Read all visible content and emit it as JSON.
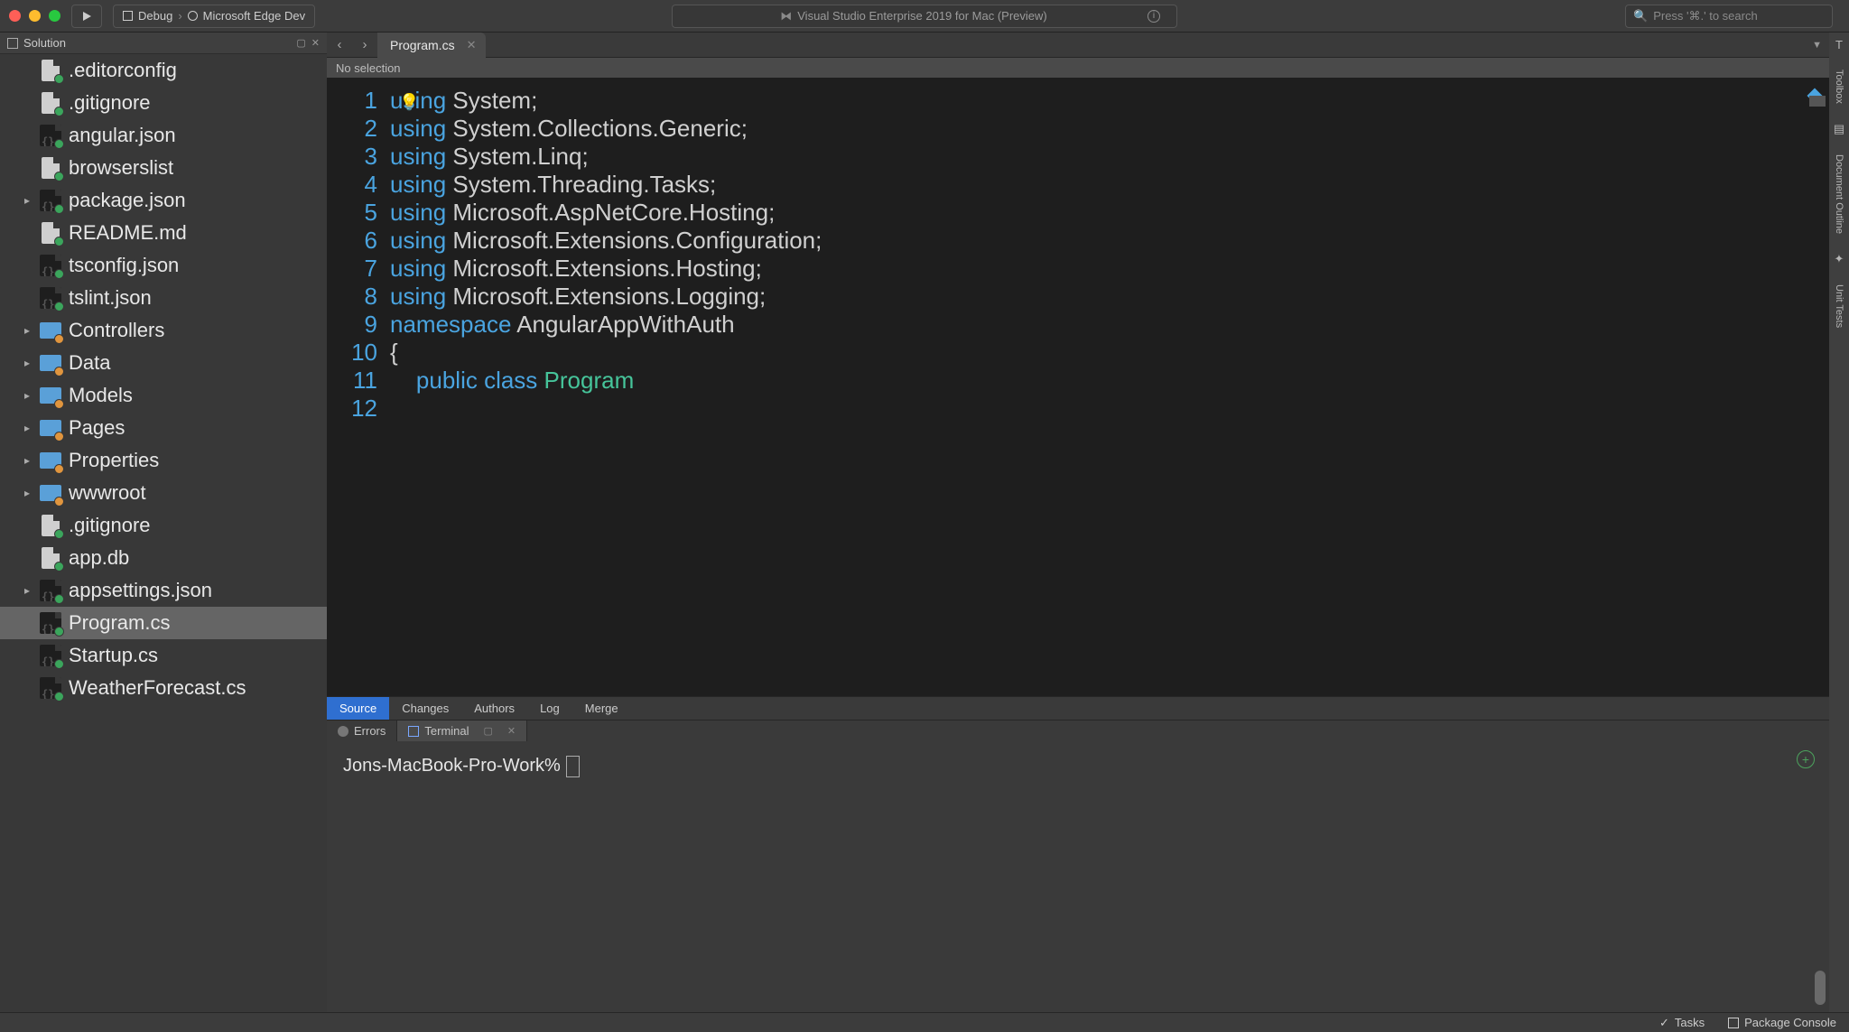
{
  "titlebar": {
    "config_label": "Debug",
    "target_label": "Microsoft Edge Dev",
    "app_title": "Visual Studio Enterprise 2019 for Mac (Preview)",
    "search_placeholder": "Press '⌘.' to search"
  },
  "sidebar": {
    "title": "Solution",
    "items": [
      {
        "label": ".editorconfig",
        "type": "file",
        "badge": "add",
        "arrow": false
      },
      {
        "label": ".gitignore",
        "type": "file",
        "badge": "add",
        "arrow": false
      },
      {
        "label": "angular.json",
        "type": "code",
        "badge": "add",
        "arrow": false
      },
      {
        "label": "browserslist",
        "type": "file",
        "badge": "add",
        "arrow": false
      },
      {
        "label": "package.json",
        "type": "code",
        "badge": "add",
        "arrow": true
      },
      {
        "label": "README.md",
        "type": "file",
        "badge": "add",
        "arrow": false
      },
      {
        "label": "tsconfig.json",
        "type": "code",
        "badge": "add",
        "arrow": false
      },
      {
        "label": "tslint.json",
        "type": "code",
        "badge": "add",
        "arrow": false
      },
      {
        "label": "Controllers",
        "type": "folder",
        "badge": "mod",
        "arrow": true
      },
      {
        "label": "Data",
        "type": "folder",
        "badge": "mod",
        "arrow": true
      },
      {
        "label": "Models",
        "type": "folder",
        "badge": "mod",
        "arrow": true
      },
      {
        "label": "Pages",
        "type": "folder",
        "badge": "mod",
        "arrow": true
      },
      {
        "label": "Properties",
        "type": "folder",
        "badge": "mod",
        "arrow": true
      },
      {
        "label": "wwwroot",
        "type": "folder",
        "badge": "mod",
        "arrow": true
      },
      {
        "label": ".gitignore",
        "type": "file",
        "badge": "add",
        "arrow": false
      },
      {
        "label": "app.db",
        "type": "file",
        "badge": "add",
        "arrow": false
      },
      {
        "label": "appsettings.json",
        "type": "code",
        "badge": "add",
        "arrow": true
      },
      {
        "label": "Program.cs",
        "type": "code",
        "badge": "add",
        "arrow": false,
        "selected": true
      },
      {
        "label": "Startup.cs",
        "type": "code",
        "badge": "add",
        "arrow": false
      },
      {
        "label": "WeatherForecast.cs",
        "type": "code",
        "badge": "add",
        "arrow": false
      }
    ]
  },
  "editor": {
    "tab_label": "Program.cs",
    "breadcrumb": "No selection",
    "line_count": 12,
    "code_lines": [
      [
        {
          "t": "using ",
          "c": "kw"
        },
        {
          "t": "System;",
          "c": ""
        }
      ],
      [
        {
          "t": "using ",
          "c": "kw"
        },
        {
          "t": "System.Collections.Generic;",
          "c": ""
        }
      ],
      [
        {
          "t": "using ",
          "c": "kw"
        },
        {
          "t": "System.Linq;",
          "c": ""
        }
      ],
      [
        {
          "t": "using ",
          "c": "kw"
        },
        {
          "t": "System.Threading.Tasks;",
          "c": ""
        }
      ],
      [
        {
          "t": "using ",
          "c": "kw"
        },
        {
          "t": "Microsoft.AspNetCore.Hosting;",
          "c": ""
        }
      ],
      [
        {
          "t": "using ",
          "c": "kw"
        },
        {
          "t": "Microsoft.Extensions.Configuration;",
          "c": ""
        }
      ],
      [
        {
          "t": "using ",
          "c": "kw"
        },
        {
          "t": "Microsoft.Extensions.Hosting;",
          "c": ""
        }
      ],
      [
        {
          "t": "using ",
          "c": "kw"
        },
        {
          "t": "Microsoft.Extensions.Logging;",
          "c": ""
        }
      ],
      [
        {
          "t": "",
          "c": ""
        }
      ],
      [
        {
          "t": "namespace ",
          "c": "kw"
        },
        {
          "t": "AngularAppWithAuth",
          "c": ""
        }
      ],
      [
        {
          "t": "{",
          "c": ""
        }
      ],
      [
        {
          "t": "    ",
          "c": ""
        },
        {
          "t": "public class ",
          "c": "kw"
        },
        {
          "t": "Program",
          "c": "ty"
        }
      ]
    ],
    "blame_tabs": [
      "Source",
      "Changes",
      "Authors",
      "Log",
      "Merge"
    ],
    "blame_active": 0
  },
  "panel": {
    "tabs": [
      {
        "label": "Errors",
        "active": false
      },
      {
        "label": "Terminal",
        "active": true
      }
    ],
    "terminal_prompt": "Jons-MacBook-Pro-Work%"
  },
  "right_tools": [
    "Toolbox",
    "Document Outline",
    "Unit Tests"
  ],
  "statusbar": {
    "tasks_label": "Tasks",
    "package_label": "Package Console"
  }
}
